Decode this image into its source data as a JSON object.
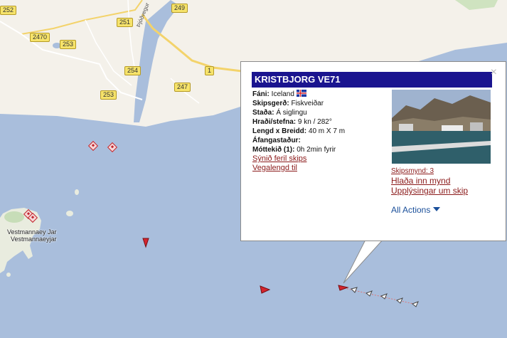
{
  "map": {
    "road_shields": [
      "252",
      "2470",
      "251",
      "253",
      "254",
      "249",
      "1",
      "247",
      "253"
    ],
    "road_name": "Þjóðvegur",
    "place_labels": [
      "Vestmannaey Jar",
      "Vestmannaeyjar"
    ]
  },
  "popup": {
    "title": "KRISTBJORG VE71",
    "close_glyph": "×",
    "fields": [
      {
        "label": "Fáni:",
        "value": "Iceland"
      },
      {
        "label": "Skipsgerð:",
        "value": "Fiskveiðar"
      },
      {
        "label": "Staða:",
        "value": "Á siglingu"
      },
      {
        "label": "Hraði/stefna:",
        "value": "9 kn / 282°"
      },
      {
        "label": "Lengd x Breidd:",
        "value": "40 m X 7 m"
      },
      {
        "label": "Áfangastaður:",
        "value": ""
      },
      {
        "label": "Móttekið (1):",
        "value": "0h 2min fyrir"
      }
    ],
    "links": [
      "Sýnið feril skips",
      "Vegalengd til"
    ],
    "photo_count": "Skipsmynd: 3",
    "photo_links": [
      "Hlaða inn mynd",
      "Upplýsingar um skip"
    ],
    "all_actions": "All Actions"
  },
  "colors": {
    "sea": "#a9bedc",
    "land": "#f4f1ea",
    "title_bar": "#1a148f",
    "vessel": "#c0262e",
    "link": "#8b1a1a"
  }
}
